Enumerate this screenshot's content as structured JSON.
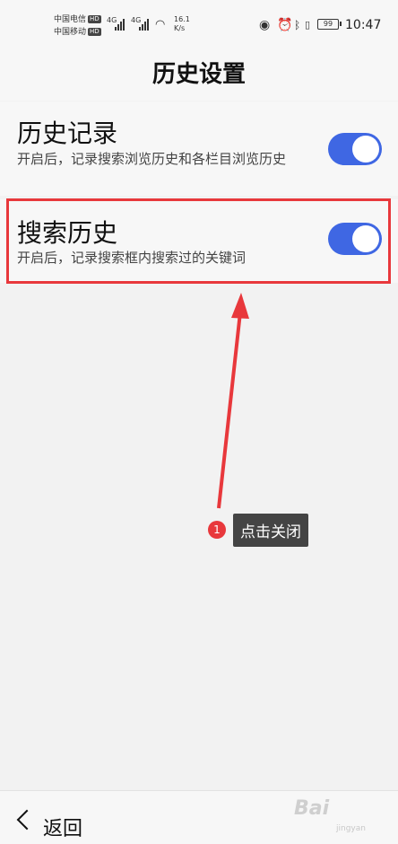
{
  "status_bar": {
    "carrier1": "中国电信",
    "carrier2": "中国移动",
    "hd": "HD",
    "net1": "4G",
    "net2": "4G",
    "speed_value": "16.1",
    "speed_unit": "K/s",
    "battery": "99",
    "time": "10:47",
    "icons": [
      "eye-icon",
      "alarm-icon",
      "bluetooth-icon",
      "vibrate-icon",
      "wifi-icon",
      "battery-icon"
    ]
  },
  "header": {
    "title": "历史设置"
  },
  "settings": [
    {
      "title": "历史记录",
      "description": "开启后，记录搜索浏览历史和各栏目浏览历史",
      "enabled": true
    },
    {
      "title": "搜索历史",
      "description": "开启后，记录搜索框内搜索过的关键词",
      "enabled": true
    }
  ],
  "annotation": {
    "step": "1",
    "label": "点击关闭",
    "color": "#e8383c"
  },
  "footer": {
    "back_label": "返回"
  },
  "accent_color": "#3f67e3",
  "watermark": {
    "text": "Bai",
    "sub": "jingyan"
  }
}
